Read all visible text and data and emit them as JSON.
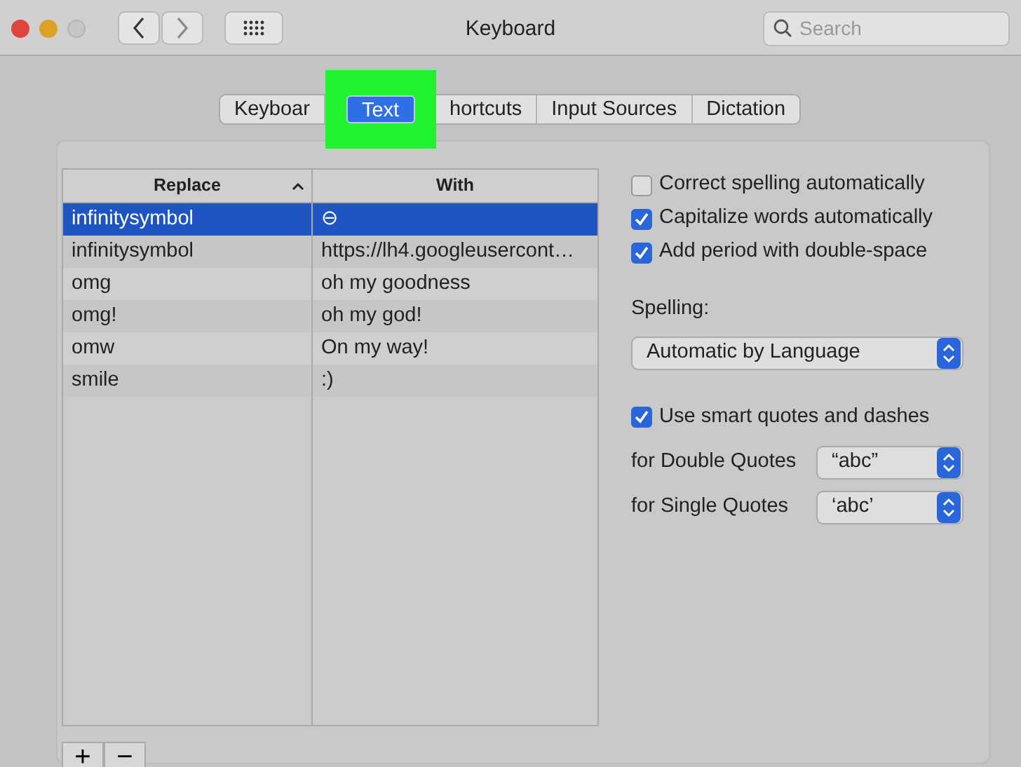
{
  "window": {
    "title": "Keyboard"
  },
  "search": {
    "placeholder": "Search"
  },
  "tabs": [
    {
      "label": "Keyboar",
      "selected": false
    },
    {
      "label": "Text",
      "selected": true,
      "highlighted": true
    },
    {
      "label": "hortcuts",
      "selected": false
    },
    {
      "label": "Input Sources",
      "selected": false
    },
    {
      "label": "Dictation",
      "selected": false
    }
  ],
  "table": {
    "columns": [
      {
        "label": "Replace",
        "sorted": true
      },
      {
        "label": "With",
        "sorted": false
      }
    ],
    "rows": [
      {
        "replace": "infinitysymbol",
        "with": "⊖",
        "selected": true
      },
      {
        "replace": "infinitysymbol",
        "with": "https://lh4.googleusercont…",
        "selected": false
      },
      {
        "replace": "omg",
        "with": "oh my goodness",
        "selected": false
      },
      {
        "replace": "omg!",
        "with": "oh my god!",
        "selected": false
      },
      {
        "replace": "omw",
        "with": "On my way!",
        "selected": false
      },
      {
        "replace": "smile",
        "with": ":)",
        "selected": false
      }
    ]
  },
  "options": [
    {
      "label": "Correct spelling automatically",
      "checked": false
    },
    {
      "label": "Capitalize words automatically",
      "checked": true
    },
    {
      "label": "Add period with double-space",
      "checked": true
    }
  ],
  "spelling": {
    "label": "Spelling:",
    "value": "Automatic by Language"
  },
  "smart_quotes": {
    "label": "Use smart quotes and dashes",
    "checked": true
  },
  "quote_settings": [
    {
      "label": "for Double Quotes",
      "value": "“abc”"
    },
    {
      "label": "for Single Quotes",
      "value": "‘abc’"
    }
  ],
  "list_buttons": [
    "+",
    "−"
  ]
}
